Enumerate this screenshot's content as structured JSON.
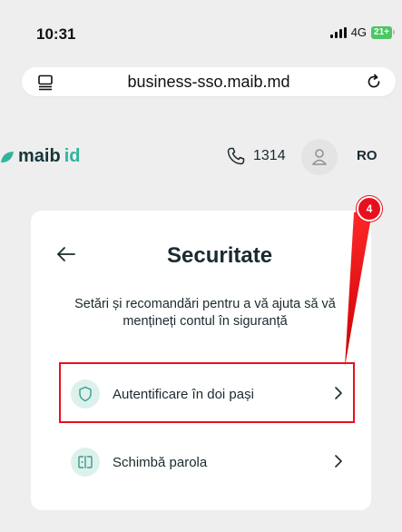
{
  "status_bar": {
    "time": "10:31",
    "network": "4G",
    "battery": "21+"
  },
  "browser": {
    "url": "business-sso.maib.md",
    "site_icon": "site-info-icon",
    "reload_icon": "reload-icon"
  },
  "header": {
    "logo_text": "maib",
    "logo_suffix": "id",
    "phone_number": "1314",
    "language": "RO"
  },
  "page": {
    "title": "Securitate",
    "subtitle": "Setări și recomandări pentru a vă ajuta să vă mențineți contul în siguranță"
  },
  "menu": [
    {
      "label": "Autentificare în doi pași",
      "icon": "shield-icon"
    },
    {
      "label": "Schimbă parola",
      "icon": "password-icon"
    }
  ],
  "annotation": {
    "step_number": "4",
    "color": "#e8101d"
  },
  "colors": {
    "accent": "#2fb59c",
    "icon_bg": "#ddf1ec",
    "text": "#1b2a2f",
    "page_bg": "#eeeeee"
  }
}
